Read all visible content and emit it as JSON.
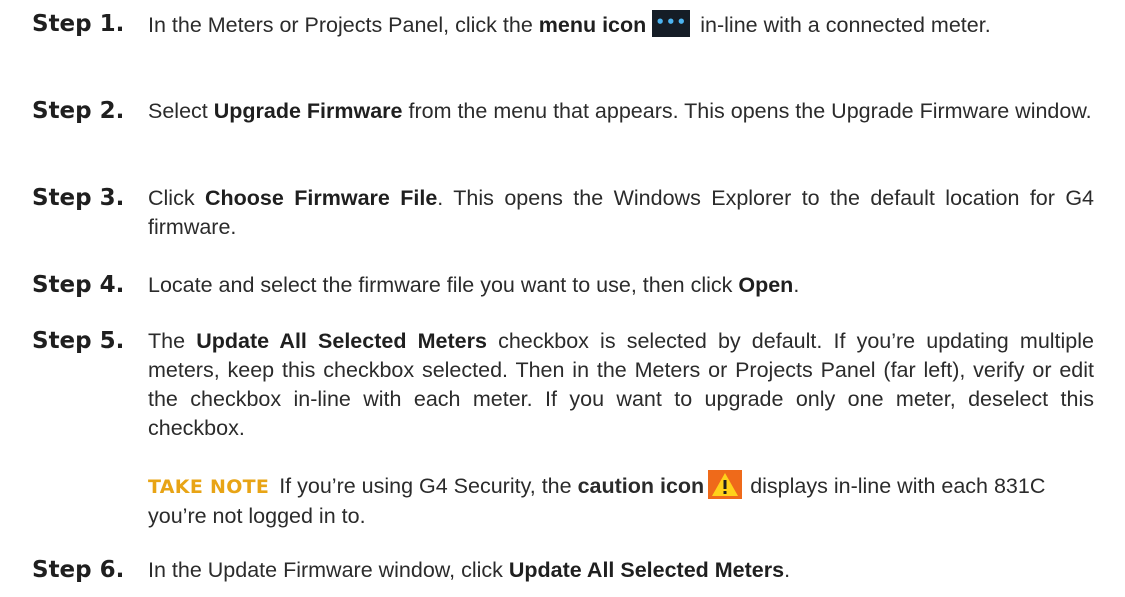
{
  "steps": [
    {
      "label": "Step 1.",
      "parts": {
        "a": "In the Meters or Projects Panel, click the ",
        "b": "menu icon",
        "c": "in-line with a connected meter."
      },
      "icon": "more-dots-icon"
    },
    {
      "label": "Step 2.",
      "parts": {
        "a": "Select ",
        "b": "Upgrade Firmware",
        "c": " from the menu that appears. This opens the Upgrade Firmware window."
      }
    },
    {
      "label": "Step 3.",
      "parts": {
        "a": "Click ",
        "b": "Choose Firmware File",
        "c": ". This opens the Windows Explorer to the default location for G4 firmware."
      }
    },
    {
      "label": "Step 4.",
      "parts": {
        "a": "Locate and select the firmware file you want to use, then click ",
        "b": "Open",
        "c": "."
      }
    },
    {
      "label": "Step 5.",
      "parts": {
        "a": "The ",
        "b": "Update All Selected Meters",
        "c": " checkbox is selected by default. If you’re updating multiple meters, keep this checkbox selected. Then in the Meters or Projects Panel (far left), verify or edit the checkbox in-line with each meter. If you want to upgrade only one meter, deselect this checkbox."
      }
    },
    {
      "label": "Step 6.",
      "parts": {
        "a": "In the Update Firmware window, click ",
        "b": "Update All Selected Meters",
        "c": "."
      }
    }
  ],
  "note": {
    "label": "TAKE NOTE",
    "a": "If you’re using G4 Security, the ",
    "b": "caution icon",
    "c": "displays in-line with each 831C you’re not logged in to.",
    "icon": "caution-warning-icon"
  },
  "colors": {
    "note_label": "#e8a415",
    "menu_icon_bg": "#151d26",
    "menu_icon_dots": "#4cb4f0",
    "caution_icon_bg": "#ef6a1a"
  }
}
